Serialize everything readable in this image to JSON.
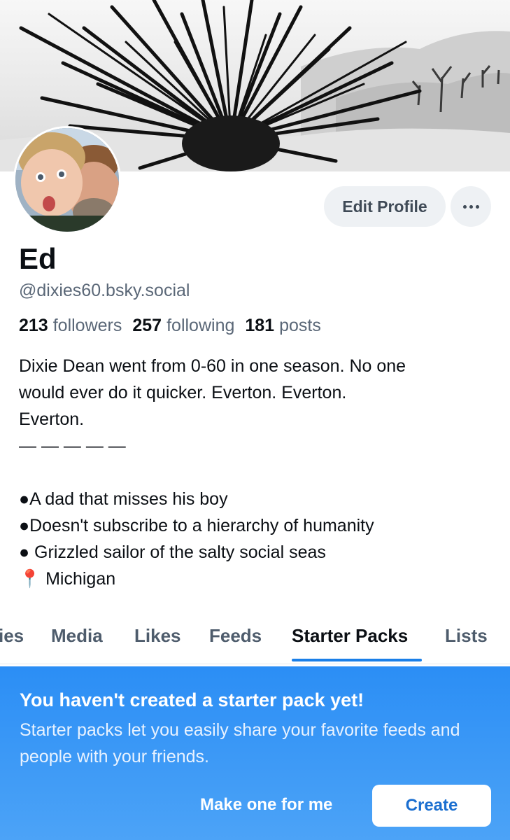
{
  "banner": {
    "alt": "Black and white desert landscape with yucca plant"
  },
  "profile": {
    "display_name": "Ed",
    "handle": "@dixies60.bsky.social",
    "edit_label": "Edit Profile",
    "more_icon": "ellipsis-icon"
  },
  "stats": {
    "followers_count": "213",
    "followers_label": "followers",
    "following_count": "257",
    "following_label": "following",
    "posts_count": "181",
    "posts_label": "posts"
  },
  "bio": {
    "lines": [
      "Dixie Dean went from 0-60 in one season. No one",
      "would ever do it quicker. Everton. Everton.",
      "Everton.",
      "— — — — —",
      "",
      "●A dad that misses his boy",
      "●Doesn't subscribe to a hierarchy of humanity",
      "● Grizzled sailor of the salty social seas",
      "📍 Michigan"
    ]
  },
  "tabs": [
    {
      "label": "ies"
    },
    {
      "label": "Media"
    },
    {
      "label": "Likes"
    },
    {
      "label": "Feeds"
    },
    {
      "label": "Starter Packs",
      "active": true
    },
    {
      "label": "Lists"
    }
  ],
  "starter_pack_promo": {
    "title": "You haven't created a starter pack yet!",
    "text": "Starter packs let you easily share your favorite feeds and people with your friends.",
    "link_label": "Make one for me",
    "button_label": "Create"
  },
  "colors": {
    "accent": "#1a7fe8",
    "promo_bg": "#2b8ef5",
    "muted_text": "#5a6777"
  }
}
